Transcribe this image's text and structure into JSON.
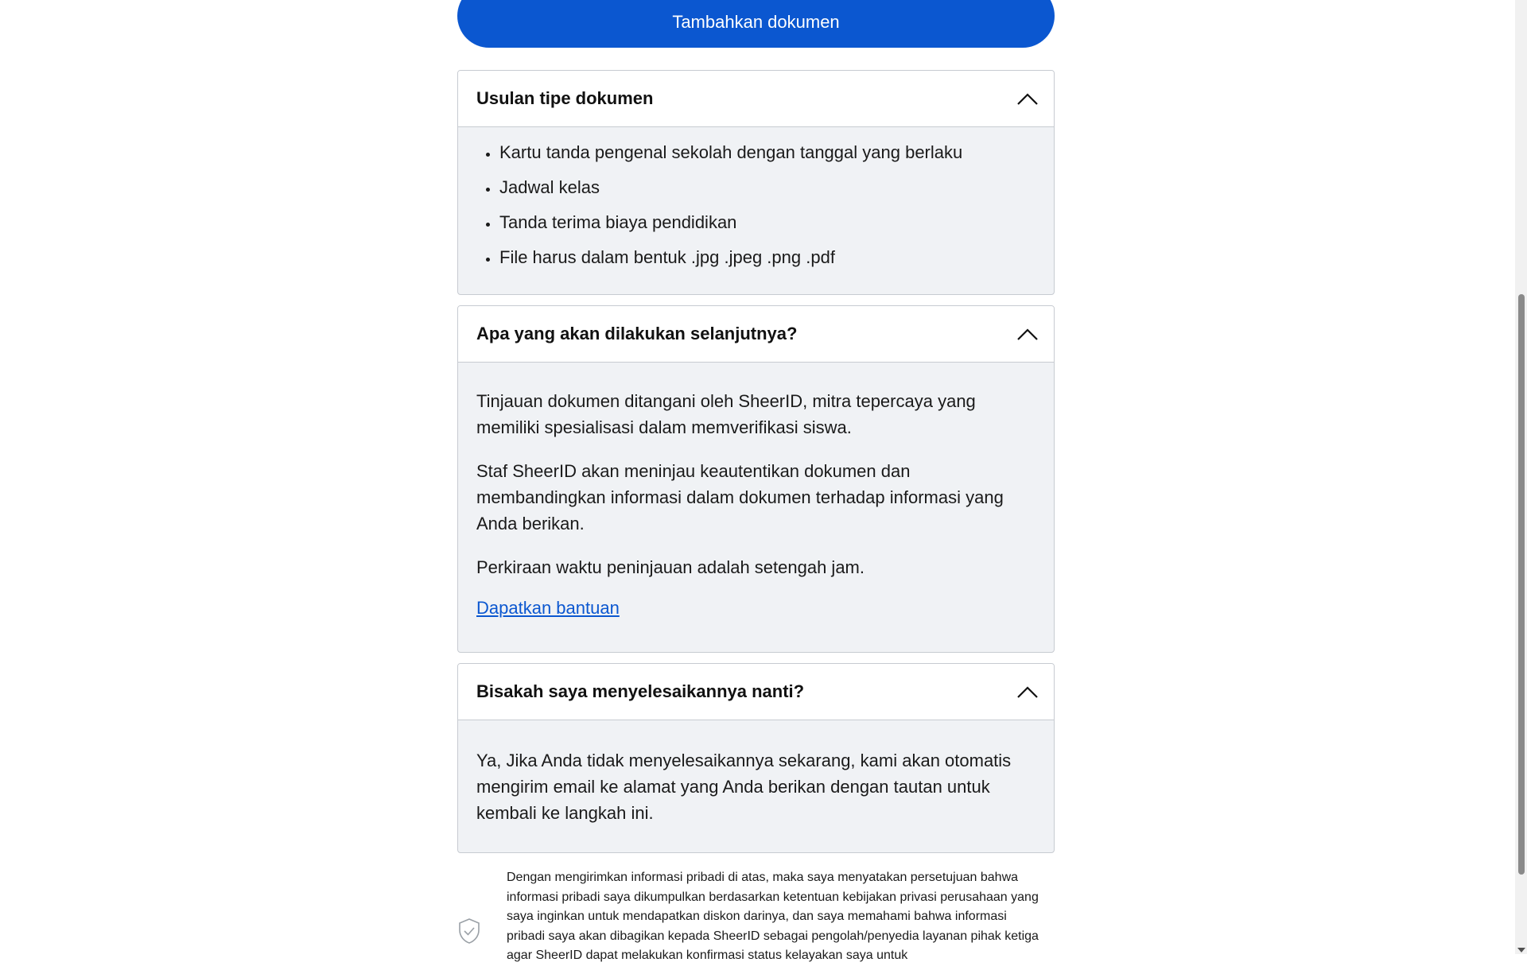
{
  "add_document_button": "Tambahkan dokumen",
  "panels": [
    {
      "title": "Usulan tipe dokumen",
      "items": [
        "Kartu tanda pengenal sekolah dengan tanggal yang berlaku",
        "Jadwal kelas",
        "Tanda terima biaya pendidikan",
        "File harus dalam bentuk .jpg .jpeg .png .pdf"
      ]
    },
    {
      "title": "Apa yang akan dilakukan selanjutnya?",
      "paragraphs": [
        "Tinjauan dokumen ditangani oleh SheerID, mitra tepercaya yang memiliki spesialisasi dalam memverifikasi siswa.",
        "Staf SheerID akan meninjau keautentikan dokumen dan membandingkan informasi dalam dokumen terhadap informasi yang Anda berikan.",
        "Perkiraan waktu peninjauan adalah setengah jam."
      ],
      "link": "Dapatkan bantuan"
    },
    {
      "title": "Bisakah saya menyelesaikannya nanti?",
      "paragraphs": [
        "Ya, Jika Anda tidak menyelesaikannya sekarang, kami akan otomatis mengirim email ke alamat yang Anda berikan dengan tautan untuk kembali ke langkah ini."
      ]
    }
  ],
  "consent": {
    "icon": "shield-check-icon",
    "text": "Dengan mengirimkan informasi pribadi di atas, maka saya menyatakan persetujuan bahwa informasi pribadi saya dikumpulkan berdasarkan ketentuan kebijakan privasi perusahaan yang saya inginkan untuk mendapatkan diskon darinya, dan saya memahami bahwa informasi pribadi saya akan dibagikan kepada SheerID sebagai pengolah/penyedia layanan pihak ketiga agar SheerID dapat melakukan konfirmasi status kelayakan saya untuk"
  },
  "colors": {
    "accent": "#0b57d0",
    "panel_body": "#f0f2f5",
    "border": "#c7cbd1"
  }
}
